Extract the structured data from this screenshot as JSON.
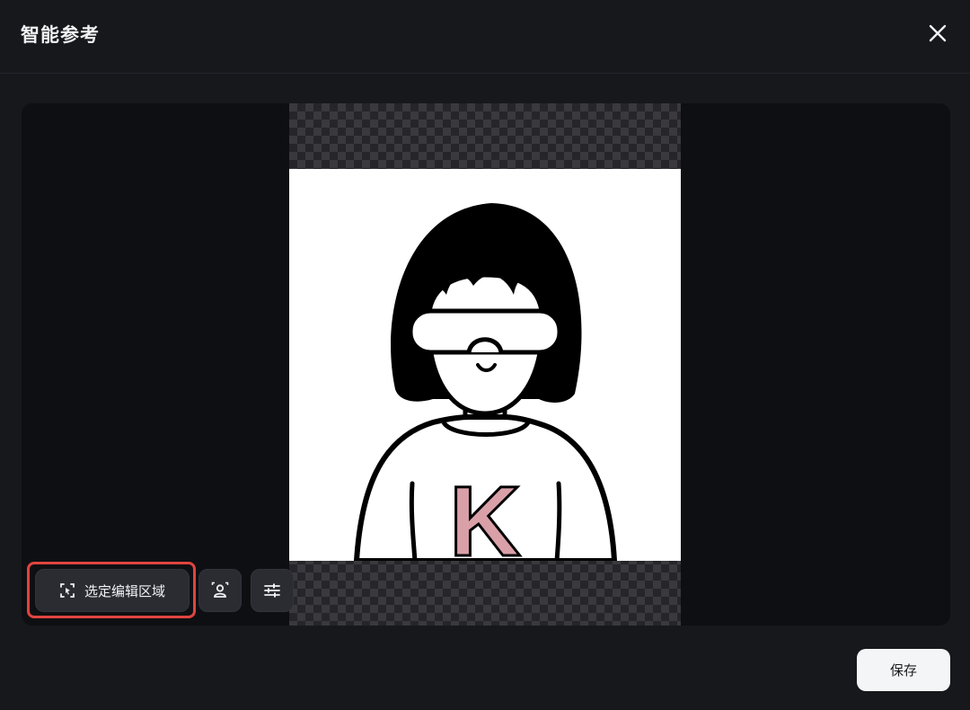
{
  "dialog": {
    "title": "智能参考",
    "close_icon": "close-icon"
  },
  "toolbar": {
    "select_region_label": "选定编辑区域",
    "select_region_icon": "region-select-icon",
    "portrait_icon": "portrait-icon",
    "adjust_icon": "sliders-icon"
  },
  "image": {
    "shirt_letter": "K",
    "letter_color": "#d9a0a8"
  },
  "footer": {
    "save_label": "保存"
  },
  "colors": {
    "background": "#17181c",
    "canvas": "#0e0f12",
    "highlight": "#e0443f"
  }
}
